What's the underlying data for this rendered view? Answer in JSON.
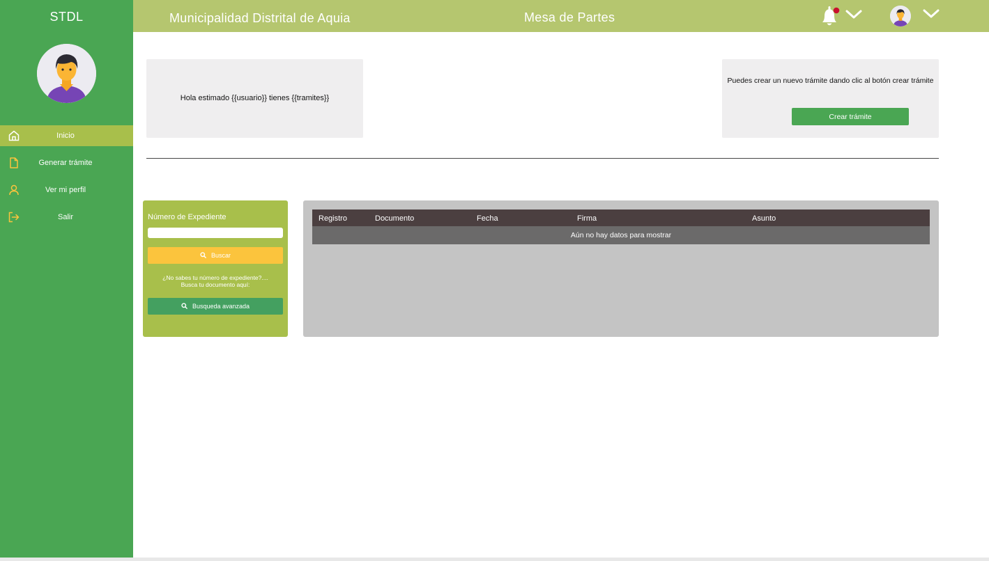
{
  "sidebar": {
    "brand": "STDL",
    "items": [
      {
        "label": "Inicio",
        "icon": "home-icon"
      },
      {
        "label": "Generar trámite",
        "icon": "document-icon"
      },
      {
        "label": "Ver mi perfil",
        "icon": "user-icon"
      },
      {
        "label": "Salir",
        "icon": "logout-icon"
      }
    ]
  },
  "header": {
    "org_title": "Municipalidad Distrital de Aquia",
    "app_title": "Mesa de Partes"
  },
  "greeting": {
    "text": "Hola estimado {{usuario}} tienes {{tramites}}"
  },
  "create": {
    "text": "Puedes crear un nuevo trámite dando clic al botón crear trámite",
    "button_label": "Crear trámite"
  },
  "search": {
    "label": "Número de Expediente",
    "input_value": "",
    "buscar_label": "Buscar",
    "hint_line1": "¿No sabes tu número de expediente?....",
    "hint_line2": "Busca tu documento aquí:",
    "advanced_label": "Busqueda avanzada"
  },
  "table": {
    "columns": [
      "Registro",
      "Documento",
      "Fecha",
      "Firma",
      "Asunto"
    ],
    "rows": [],
    "empty_message": "Aún no hay datos para mostrar"
  },
  "colors": {
    "sidebar": "#4aa653",
    "active_nav": "#a8bf4b",
    "topbar": "#b5c66f",
    "icon_yellow": "#fbc43d",
    "notification_dot": "#c8102e",
    "table_header": "#4b3f40"
  }
}
